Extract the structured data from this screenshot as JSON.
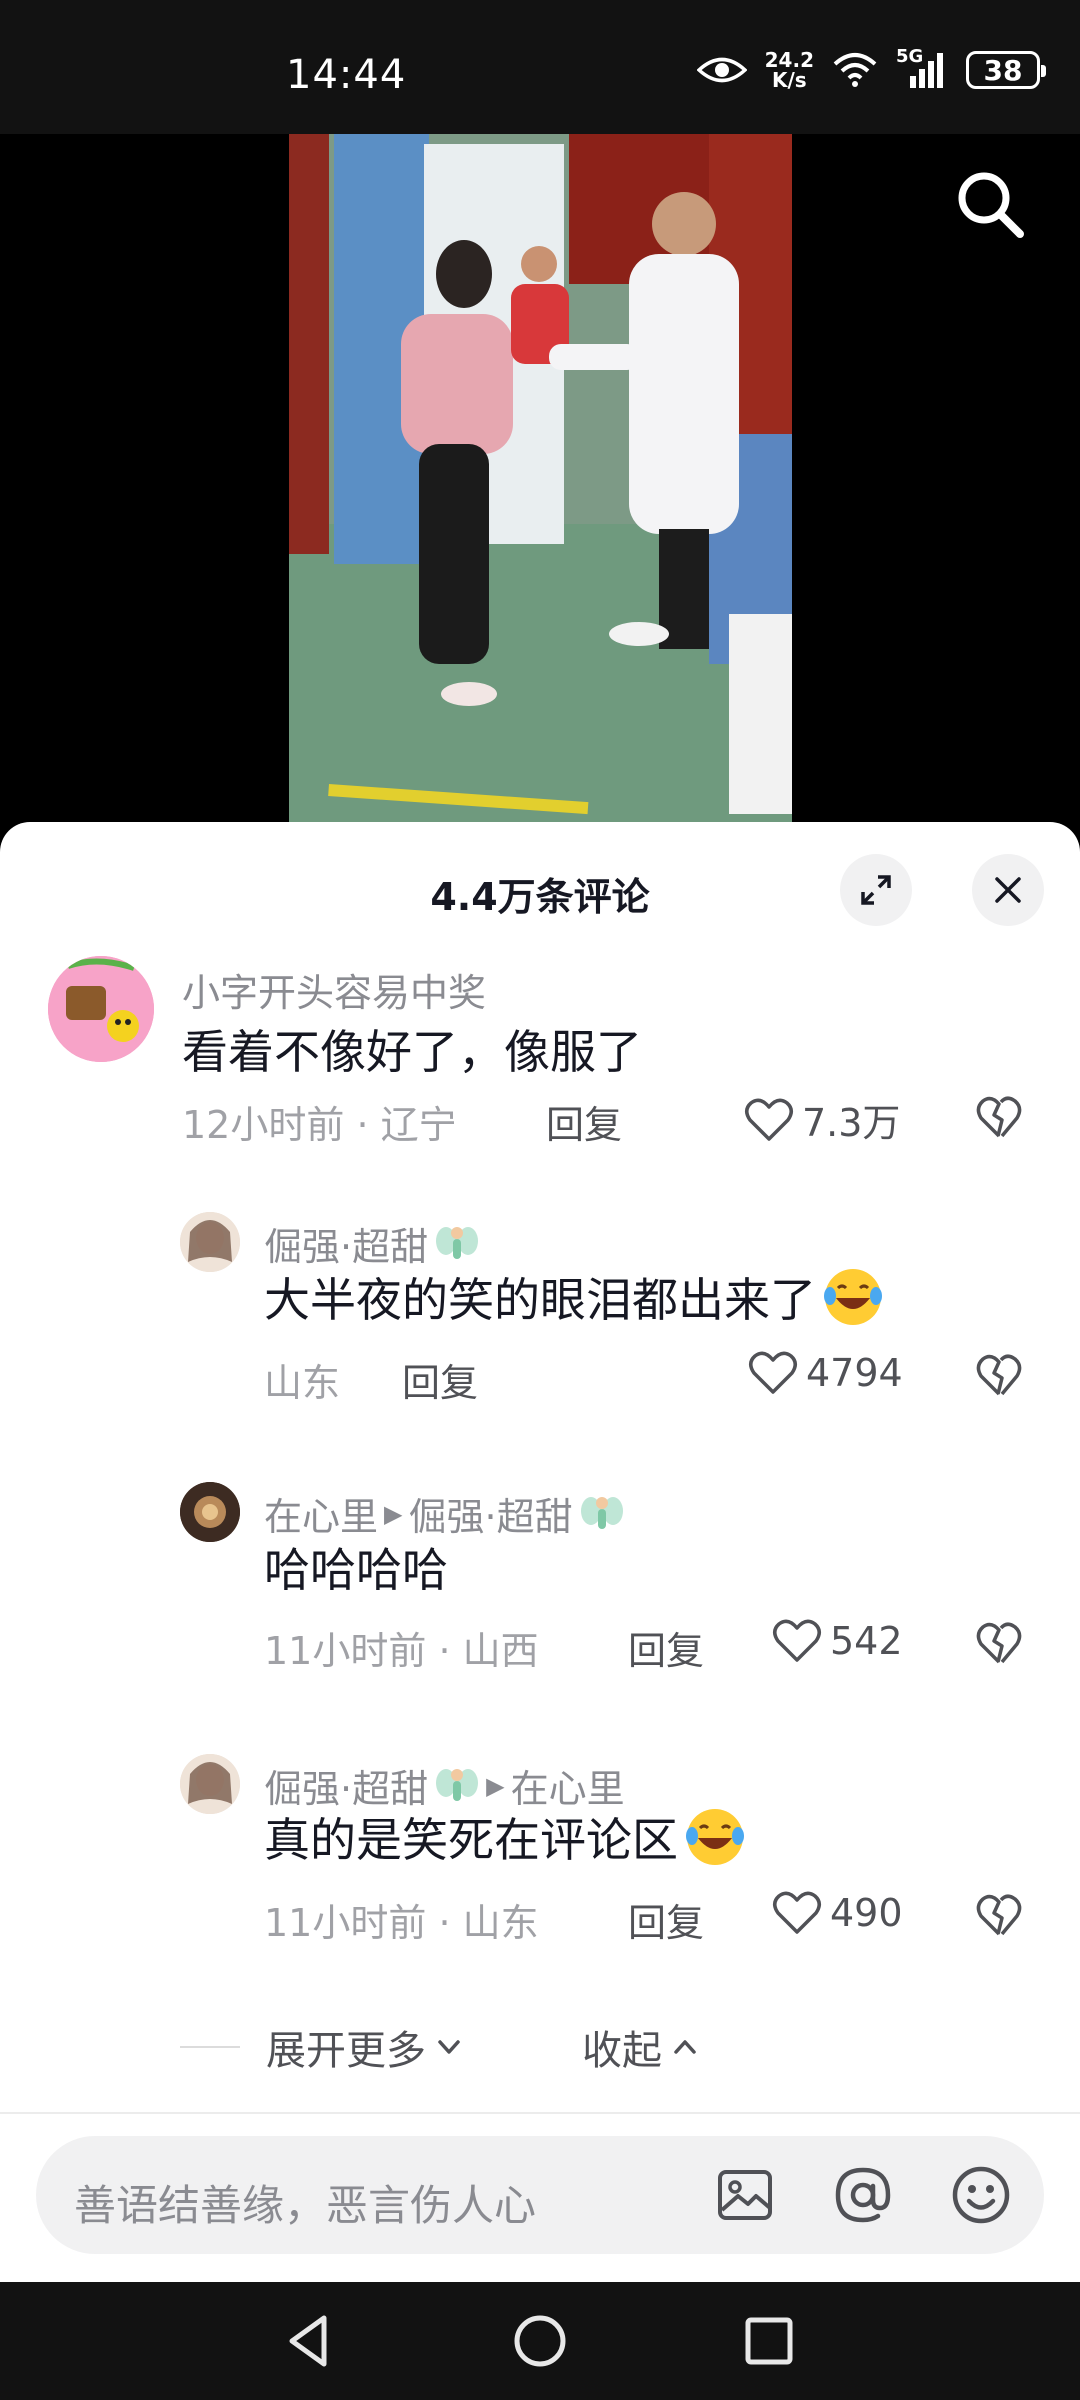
{
  "status_bar": {
    "time": "14:44",
    "net_speed_value": "24.2",
    "net_speed_unit": "K/s",
    "network_type": "5G",
    "battery": "38"
  },
  "comments_panel": {
    "title": "4.4万条评论",
    "comments": [
      {
        "username": "小字开头容易中奖",
        "text": "看着不像好了，像服了",
        "time": "12小时前",
        "location": "辽宁",
        "reply_label": "回复",
        "likes": "7.3万"
      },
      {
        "username": "倔强·超甜",
        "text": "大半夜的笑的眼泪都出来了",
        "location": "山东",
        "reply_label": "回复",
        "likes": "4794"
      },
      {
        "username": "在心里",
        "reply_to": "倔强·超甜",
        "text": "哈哈哈哈",
        "time": "11小时前",
        "location": "山西",
        "reply_label": "回复",
        "likes": "542"
      },
      {
        "username": "倔强·超甜",
        "reply_to": "在心里",
        "text": "真的是笑死在评论区",
        "time": "11小时前",
        "location": "山东",
        "reply_label": "回复",
        "likes": "490"
      }
    ],
    "expand_more_label": "展开更多",
    "collapse_label": "收起"
  },
  "input_bar": {
    "placeholder": "善语结善缘，恶言伤人心"
  },
  "colors": {
    "accent_text": "#161823",
    "secondary_text": "#8a8b91",
    "sheet_bg": "#ffffff"
  },
  "icons": [
    "eye-icon",
    "wifi-icon",
    "signal-icon",
    "battery-icon",
    "search-icon",
    "expand-icon",
    "close-icon",
    "heart-icon",
    "broken-heart-icon",
    "fairy-emoji-icon",
    "laugh-cry-emoji-icon",
    "image-icon",
    "at-icon",
    "smiley-icon",
    "back-nav-icon",
    "home-nav-icon",
    "recents-nav-icon"
  ]
}
